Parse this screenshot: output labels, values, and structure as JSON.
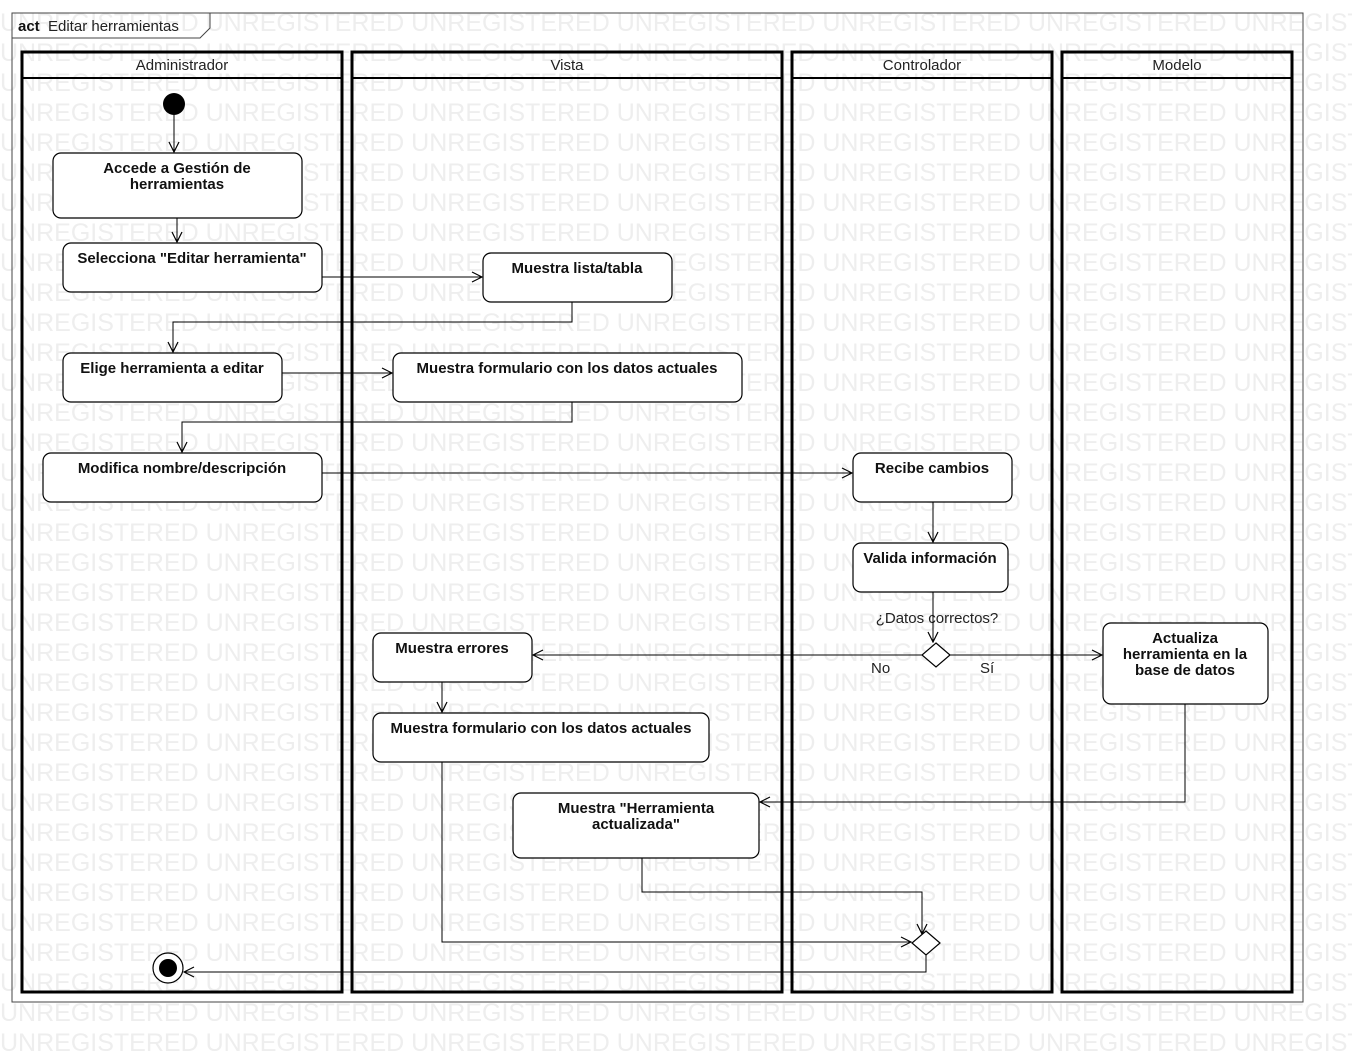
{
  "watermark_text": "UNREGISTERED",
  "frame": {
    "keyword": "act",
    "name": "Editar herramientas"
  },
  "lanes": [
    "Administrador",
    "Vista",
    "Controlador",
    "Modelo"
  ],
  "actions": {
    "accede": [
      "Accede a Gestión de",
      "herramientas"
    ],
    "selecciona": [
      "Selecciona \"Editar herramienta\""
    ],
    "lista": [
      "Muestra lista/tabla"
    ],
    "elige": [
      "Elige herramienta a editar"
    ],
    "formulario1": [
      "Muestra formulario con los datos actuales"
    ],
    "modifica": [
      "Modifica nombre/descripción"
    ],
    "recibe": [
      "Recibe cambios"
    ],
    "valida": [
      "Valida información"
    ],
    "errores": [
      "Muestra errores"
    ],
    "actualiza": [
      "Actualiza",
      "herramienta en la",
      "base de datos"
    ],
    "formulario2": [
      "Muestra formulario con los datos actuales"
    ],
    "confirmacion": [
      "Muestra \"Herramienta",
      "actualizada\""
    ]
  },
  "decision": {
    "question": "¿Datos correctos?",
    "no": "No",
    "yes": "Sí"
  },
  "colors": {
    "line": "#000000",
    "watermark": "#eeeeee"
  }
}
